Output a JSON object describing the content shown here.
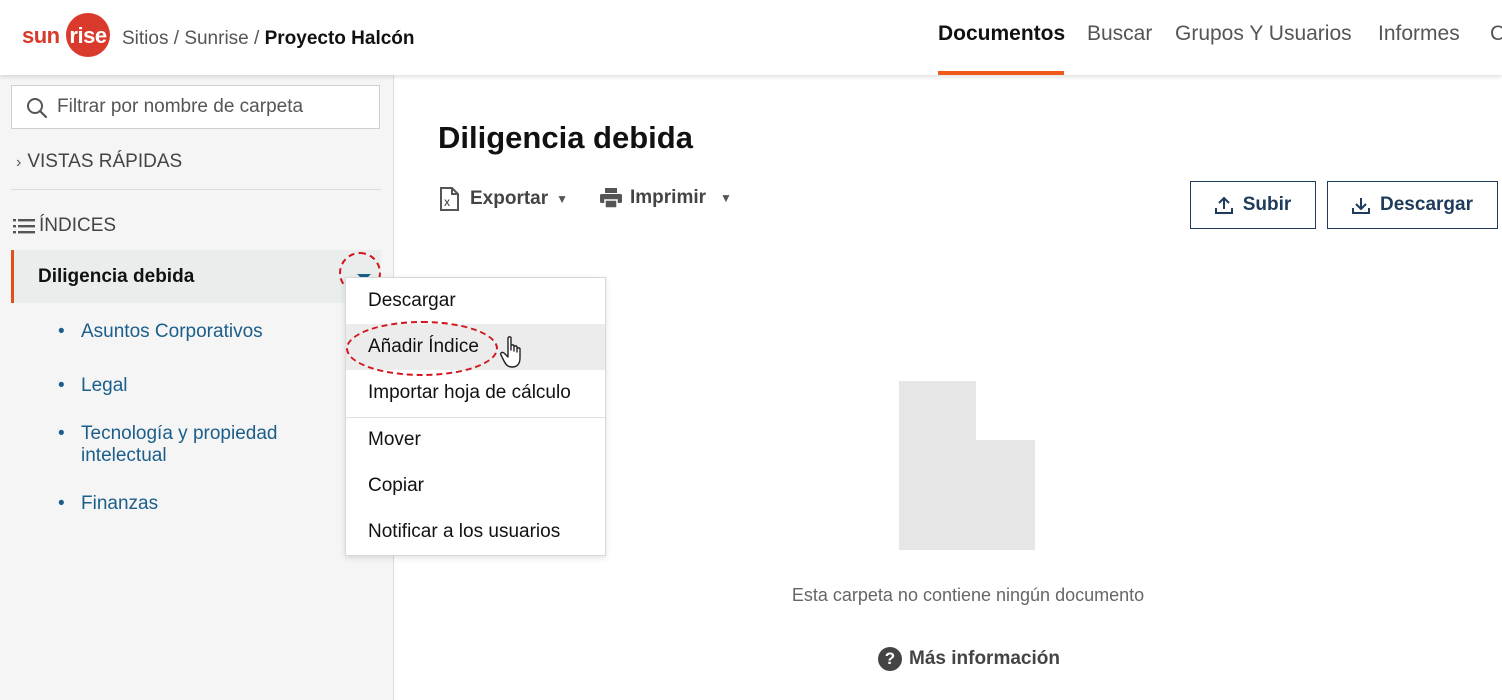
{
  "header": {
    "logo": "sunrise",
    "breadcrumb": {
      "parts": [
        "Sitios",
        "Sunrise"
      ],
      "separator": "/",
      "current": "Proyecto Halcón"
    },
    "nav": [
      {
        "label": "Documentos",
        "active": true
      },
      {
        "label": "Buscar",
        "active": false
      },
      {
        "label": "Grupos Y Usuarios",
        "active": false
      },
      {
        "label": "Informes",
        "active": false
      },
      {
        "label": "C",
        "active": false
      }
    ],
    "accent_color": "#f25a1b"
  },
  "sidebar": {
    "search": {
      "placeholder": "Filtrar por nombre de carpeta",
      "value": ""
    },
    "quick_views": "VISTAS RÁPIDAS",
    "indices_title": "ÍNDICES",
    "active_folder": "Diligencia debida",
    "children": [
      {
        "label": "Asuntos Corporativos"
      },
      {
        "label": "Legal"
      },
      {
        "label": "Tecnología y propiedad intelectual"
      },
      {
        "label": "Finanzas"
      }
    ]
  },
  "context_menu": {
    "items": [
      {
        "label": "Descargar"
      },
      {
        "label": "Añadir Índice",
        "hovered": true
      },
      {
        "label": "Importar hoja de cálculo"
      },
      {
        "label": "Mover"
      },
      {
        "label": "Copiar"
      },
      {
        "label": "Notificar a los usuarios"
      }
    ],
    "highlight_color": "#d4141c"
  },
  "main": {
    "title": "Diligencia debida",
    "toolbar": {
      "export": "Exportar",
      "print": "Imprimir"
    },
    "buttons": {
      "upload": "Subir",
      "download": "Descargar"
    },
    "empty_text": "Esta carpeta no contiene ningún documento",
    "more_info": "Más información"
  }
}
